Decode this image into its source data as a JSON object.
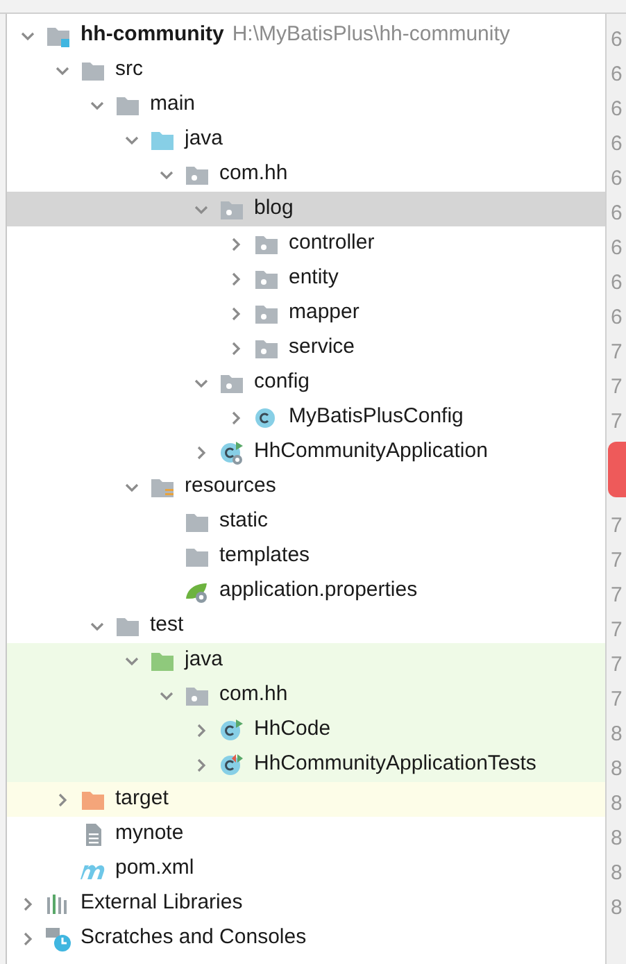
{
  "tree": [
    {
      "label": "hh-community",
      "path": "H:\\MyBatisPlus\\hh-community",
      "kind": "module",
      "expanded": true,
      "selected": false,
      "children": [
        {
          "label": "src",
          "kind": "folder",
          "expanded": true,
          "selected": false,
          "children": [
            {
              "label": "main",
              "kind": "folder",
              "expanded": true,
              "selected": false,
              "children": [
                {
                  "label": "java",
                  "kind": "source",
                  "expanded": true,
                  "selected": false,
                  "children": [
                    {
                      "label": "com.hh",
                      "kind": "package",
                      "expanded": true,
                      "selected": false,
                      "children": [
                        {
                          "label": "blog",
                          "kind": "package",
                          "expanded": true,
                          "selected": true,
                          "children": [
                            {
                              "label": "controller",
                              "kind": "package",
                              "expanded": false,
                              "selected": false
                            },
                            {
                              "label": "entity",
                              "kind": "package",
                              "expanded": false,
                              "selected": false
                            },
                            {
                              "label": "mapper",
                              "kind": "package",
                              "expanded": false,
                              "selected": false
                            },
                            {
                              "label": "service",
                              "kind": "package",
                              "expanded": false,
                              "selected": false
                            }
                          ]
                        },
                        {
                          "label": "config",
                          "kind": "package",
                          "expanded": true,
                          "selected": false,
                          "children": [
                            {
                              "label": "MyBatisPlusConfig",
                              "kind": "class",
                              "expanded": false,
                              "selected": false
                            }
                          ]
                        },
                        {
                          "label": "HhCommunityApplication",
                          "kind": "spring-class",
                          "expanded": false,
                          "selected": false
                        }
                      ]
                    }
                  ]
                },
                {
                  "label": "resources",
                  "kind": "resources",
                  "expanded": true,
                  "selected": false,
                  "children": [
                    {
                      "label": "static",
                      "kind": "folder",
                      "selected": false
                    },
                    {
                      "label": "templates",
                      "kind": "folder",
                      "selected": false
                    },
                    {
                      "label": "application.properties",
                      "kind": "properties",
                      "selected": false
                    }
                  ]
                }
              ]
            },
            {
              "label": "test",
              "kind": "folder",
              "expanded": true,
              "selected": false,
              "children": [
                {
                  "label": "java",
                  "kind": "test-source",
                  "color": "#effae7",
                  "expanded": true,
                  "selected": false,
                  "children": [
                    {
                      "label": "com.hh",
                      "kind": "package",
                      "color": "#effae7",
                      "expanded": true,
                      "selected": false,
                      "children": [
                        {
                          "label": "HhCode",
                          "kind": "run-class",
                          "color": "#effae7",
                          "expanded": false,
                          "selected": false
                        },
                        {
                          "label": "HhCommunityApplicationTests",
                          "kind": "test-class",
                          "color": "#effae7",
                          "expanded": false,
                          "selected": false
                        }
                      ]
                    }
                  ]
                }
              ]
            }
          ]
        },
        {
          "label": "target",
          "kind": "excluded",
          "color": "#fdfde8",
          "expanded": false,
          "selected": false
        },
        {
          "label": "mynote",
          "kind": "text",
          "selected": false
        },
        {
          "label": "pom.xml",
          "kind": "maven",
          "selected": false
        }
      ]
    },
    {
      "label": "External Libraries",
      "kind": "libraries",
      "expanded": false,
      "selected": false
    },
    {
      "label": "Scratches and Consoles",
      "kind": "scratches",
      "expanded": false,
      "selected": false
    }
  ],
  "gutter": [
    "6",
    "6",
    "6",
    "6",
    "6",
    "6",
    "6",
    "6",
    "6",
    "7",
    "7",
    "7",
    "7",
    "7",
    "7",
    "7",
    "7",
    "7",
    "8",
    "8",
    "8",
    "8",
    "8",
    "8"
  ]
}
